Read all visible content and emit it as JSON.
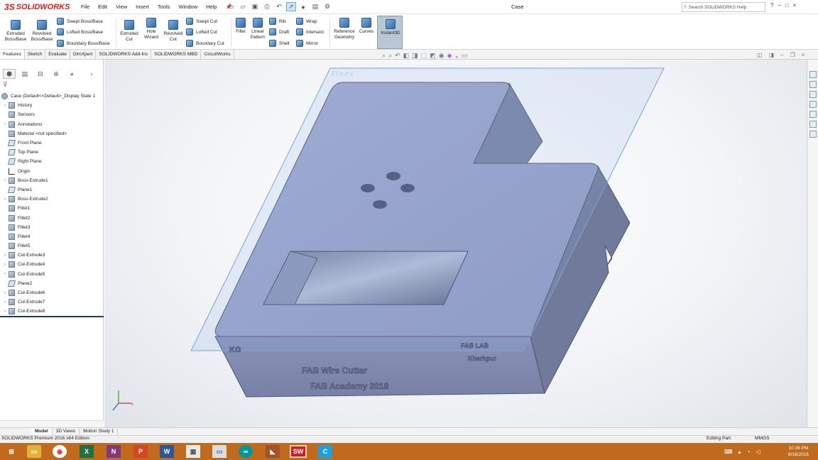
{
  "app": {
    "name": "SOLIDWORKS",
    "ds_mark": "3S"
  },
  "menu": [
    "File",
    "Edit",
    "View",
    "Insert",
    "Tools",
    "Window",
    "Help"
  ],
  "document_title": "Case",
  "help_search": {
    "placeholder": "Search SOLIDWORKS Help"
  },
  "window_controls": [
    "?",
    "–",
    "□",
    "×"
  ],
  "ribbon": {
    "extruded_boss": "Extruded\nBoss/Base",
    "revolved_boss": "Revolved\nBoss/Base",
    "swept_boss": "Swept Boss/Base",
    "lofted_boss": "Lofted Boss/Base",
    "boundary_boss": "Boundary Boss/Base",
    "extruded_cut": "Extruded\nCut",
    "hole_wizard": "Hole\nWizard",
    "revolved_cut": "Revolved\nCut",
    "swept_cut": "Swept Cut",
    "lofted_cut": "Lofted Cut",
    "boundary_cut": "Boundary Cut",
    "fillet": "Fillet",
    "linear_pattern": "Linear\nPattern",
    "rib": "Rib",
    "draft": "Draft",
    "shell": "Shell",
    "wrap": "Wrap",
    "intersect": "Intersect",
    "mirror": "Mirror",
    "reference_geometry": "Reference\nGeometry",
    "curves": "Curves",
    "instant3d": "Instant3D"
  },
  "command_tabs": [
    "Features",
    "Sketch",
    "Evaluate",
    "DimXpert",
    "SOLIDWORKS Add-Ins",
    "SOLIDWORKS MBD",
    "CircuitWorks"
  ],
  "tree": {
    "root": "Case  (Default<<Default>_Display State 1",
    "items": [
      {
        "label": "History",
        "expand": "›",
        "kind": "feat"
      },
      {
        "label": "Sensors",
        "expand": "",
        "kind": "feat"
      },
      {
        "label": "Annotations",
        "expand": "›",
        "kind": "feat"
      },
      {
        "label": "Material <not specified>",
        "expand": "",
        "kind": "feat"
      },
      {
        "label": "Front Plane",
        "expand": "",
        "kind": "plane"
      },
      {
        "label": "Top Plane",
        "expand": "",
        "kind": "plane"
      },
      {
        "label": "Right Plane",
        "expand": "",
        "kind": "plane"
      },
      {
        "label": "Origin",
        "expand": "",
        "kind": "origin"
      },
      {
        "label": "Boss-Extrude1",
        "expand": "›",
        "kind": "feat"
      },
      {
        "label": "Plane1",
        "expand": "",
        "kind": "plane"
      },
      {
        "label": "Boss-Extrude2",
        "expand": "›",
        "kind": "feat"
      },
      {
        "label": "Fillet1",
        "expand": "",
        "kind": "feat"
      },
      {
        "label": "Fillet2",
        "expand": "",
        "kind": "feat"
      },
      {
        "label": "Fillet3",
        "expand": "",
        "kind": "feat"
      },
      {
        "label": "Fillet4",
        "expand": "",
        "kind": "feat"
      },
      {
        "label": "Fillet5",
        "expand": "",
        "kind": "feat"
      },
      {
        "label": "Cut-Extrude3",
        "expand": "›",
        "kind": "feat"
      },
      {
        "label": "Cut-Extrude4",
        "expand": "›",
        "kind": "feat"
      },
      {
        "label": "Cut-Extrude5",
        "expand": "›",
        "kind": "feat"
      },
      {
        "label": "Plane2",
        "expand": "",
        "kind": "plane"
      },
      {
        "label": "Cut-Extrude6",
        "expand": "›",
        "kind": "feat"
      },
      {
        "label": "Cut-Extrude7",
        "expand": "›",
        "kind": "feat"
      },
      {
        "label": "Cut-Extrude8",
        "expand": "›",
        "kind": "feat"
      }
    ]
  },
  "model": {
    "plane_label": "Plane1",
    "engrave_left": "KG",
    "engrave_right_1": "FAB LAB",
    "engrave_right_2": "Kharkpur",
    "engrave_front_1": "FAB Wire Cutter",
    "engrave_front_2": "FAB Academy 2018"
  },
  "bottom_tabs": [
    "Model",
    "3D Views",
    "Motion Study 1"
  ],
  "status": {
    "edition": "SOLIDWORKS Premium 2016 x64 Edition",
    "mode": "Editing Part",
    "units": "MMGS"
  },
  "clock": {
    "time": "10:36 PM",
    "date": "6/18/2018"
  },
  "colors": {
    "accent": "#d02020",
    "taskbar": "#bf6a1c",
    "part": "#9aa2c4",
    "plane": "#7aa3dc"
  }
}
